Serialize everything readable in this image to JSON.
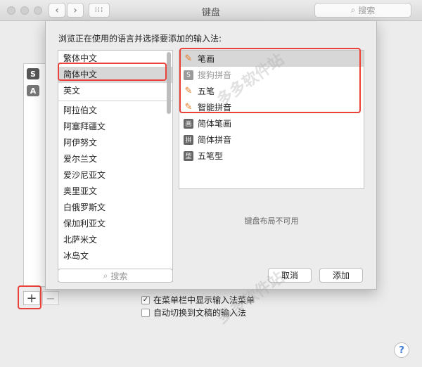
{
  "window": {
    "title": "键盘",
    "search_placeholder": "搜索"
  },
  "background": {
    "add_label": "+",
    "remove_label": "−"
  },
  "options": [
    {
      "label": "在菜单栏中显示输入法菜单",
      "checked": true
    },
    {
      "label": "自动切换到文稿的输入法",
      "checked": false
    }
  ],
  "help_label": "?",
  "sheet": {
    "prompt": "浏览正在使用的语言并选择要添加的输入法:",
    "languages_top": [
      "繁体中文",
      "简体中文",
      "英文"
    ],
    "languages": [
      "阿拉伯文",
      "阿塞拜疆文",
      "阿伊努文",
      "爱尔兰文",
      "爱沙尼亚文",
      "奥里亚文",
      "白俄罗斯文",
      "保加利亚文",
      "北萨米文",
      "冰岛文"
    ],
    "selected_language": "简体中文",
    "methods": [
      {
        "label": "笔画",
        "icon": "pencil-icon",
        "selected": true,
        "disabled": false
      },
      {
        "label": "搜狗拼音",
        "icon": "sogou-icon",
        "selected": false,
        "disabled": true
      },
      {
        "label": "五笔",
        "icon": "pencil-icon",
        "selected": false,
        "disabled": false
      },
      {
        "label": "智能拼音",
        "icon": "pencil-icon",
        "selected": false,
        "disabled": false
      },
      {
        "label": "简体笔画",
        "icon": "stroke-icon",
        "icon_char": "画",
        "selected": false,
        "disabled": false
      },
      {
        "label": "简体拼音",
        "icon": "pinyin-icon",
        "icon_char": "拼",
        "selected": false,
        "disabled": false
      },
      {
        "label": "五笔型",
        "icon": "wubi-icon",
        "icon_char": "型",
        "selected": false,
        "disabled": false
      }
    ],
    "layout_unavailable": "键盘布局不可用",
    "search_placeholder": "搜索",
    "cancel_label": "取消",
    "add_label": "添加"
  },
  "watermark": "多多软件站",
  "colors": {
    "highlight": "#e8423a",
    "selection": "#d7d7d7",
    "sogou": "#9a9a9a",
    "pencil": "#e67a1e"
  }
}
